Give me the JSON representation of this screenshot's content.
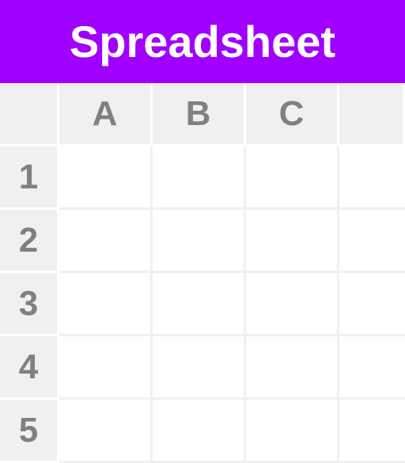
{
  "header": {
    "title": "Spreadsheet"
  },
  "columns": [
    "A",
    "B",
    "C"
  ],
  "rows": [
    "1",
    "2",
    "3",
    "4",
    "5"
  ],
  "cells": {
    "A1": "",
    "B1": "",
    "C1": "",
    "A2": "",
    "B2": "",
    "C2": "",
    "A3": "",
    "B3": "",
    "C3": "",
    "A4": "",
    "B4": "",
    "C4": "",
    "A5": "",
    "B5": "",
    "C5": ""
  }
}
